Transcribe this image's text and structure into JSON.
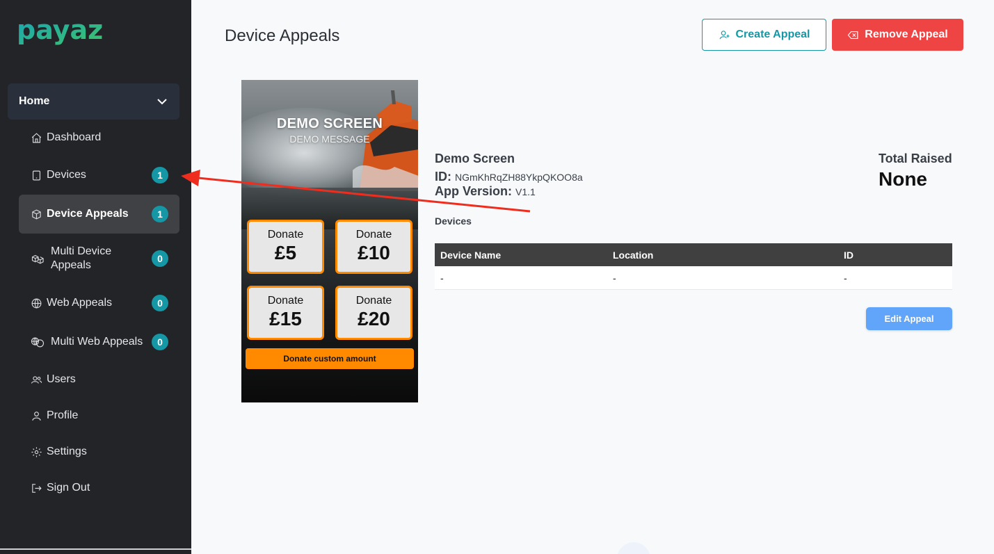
{
  "app": {
    "logo_text": "payaz",
    "brand_color": "#1697a6"
  },
  "sidebar": {
    "home_label": "Home",
    "items": [
      {
        "label": "Dashboard",
        "icon": "home-icon"
      },
      {
        "label": "Devices",
        "icon": "tablet-icon",
        "badge": "1"
      },
      {
        "label": "Device Appeals",
        "icon": "box-icon",
        "badge": "1",
        "active": true
      },
      {
        "label": "Multi Device\nAppeals",
        "icon": "boxes-icon",
        "badge": "0"
      },
      {
        "label": "Web Appeals",
        "icon": "globe-icon",
        "badge": "0"
      },
      {
        "label": "Multi Web Appeals",
        "icon": "globes-icon",
        "badge": "0"
      },
      {
        "label": "Users",
        "icon": "users-icon"
      },
      {
        "label": "Profile",
        "icon": "user-icon"
      },
      {
        "label": "Settings",
        "icon": "gear-icon"
      },
      {
        "label": "Sign Out",
        "icon": "sign-out-icon"
      }
    ]
  },
  "header": {
    "title": "Device Appeals",
    "create_label": "Create Appeal",
    "remove_label": "Remove Appeal"
  },
  "preview": {
    "title": "DEMO SCREEN",
    "message": "DEMO MESSAGE",
    "tiles": [
      {
        "label": "Donate",
        "amount": "£5"
      },
      {
        "label": "Donate",
        "amount": "£10"
      },
      {
        "label": "Donate",
        "amount": "£15"
      },
      {
        "label": "Donate",
        "amount": "£20"
      }
    ],
    "custom_label": "Donate custom amount",
    "accent": "#ff8a00"
  },
  "appeal": {
    "name": "Demo Screen",
    "id_label": "ID:",
    "id_value": "NGmKhRqZH88YkpQKOO8a",
    "version_label": "App Version:",
    "version_value": "V1.1",
    "devices_label": "Devices",
    "total_label": "Total Raised",
    "total_value": "None"
  },
  "devices_table": {
    "headers": [
      "Device Name",
      "Location",
      "ID"
    ],
    "rows": [
      [
        "-",
        "-",
        "-"
      ]
    ]
  },
  "edit_label": "Edit Appeal"
}
